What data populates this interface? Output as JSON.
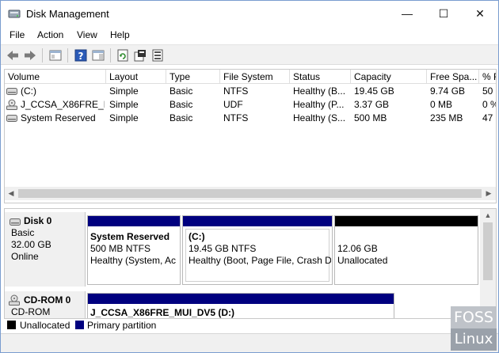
{
  "window": {
    "title": "Disk Management"
  },
  "controls": {
    "minimize": "—",
    "maximize": "☐",
    "close": "✕"
  },
  "menu": {
    "file": "File",
    "action": "Action",
    "view": "View",
    "help": "Help"
  },
  "toolbar": {
    "icons": [
      "back-arrow-icon",
      "forward-arrow-icon",
      "console-tree-icon",
      "help-icon",
      "show-pane-icon",
      "refresh-icon",
      "properties-icon",
      "rescan-disks-icon"
    ]
  },
  "volumes": {
    "columns": [
      "Volume",
      "Layout",
      "Type",
      "File System",
      "Status",
      "Capacity",
      "Free Spa...",
      "% F"
    ],
    "rows": [
      {
        "volume": "(C:)",
        "layout": "Simple",
        "type": "Basic",
        "fs": "NTFS",
        "status": "Healthy (B...",
        "capacity": "19.45 GB",
        "free": "9.74 GB",
        "pct": "50"
      },
      {
        "volume": "J_CCSA_X86FRE_M...",
        "layout": "Simple",
        "type": "Basic",
        "fs": "UDF",
        "status": "Healthy (P...",
        "capacity": "3.37 GB",
        "free": "0 MB",
        "pct": "0 %"
      },
      {
        "volume": "System Reserved",
        "layout": "Simple",
        "type": "Basic",
        "fs": "NTFS",
        "status": "Healthy (S...",
        "capacity": "500 MB",
        "free": "235 MB",
        "pct": "47"
      }
    ]
  },
  "disk0": {
    "name": "Disk 0",
    "kind": "Basic",
    "size": "32.00 GB",
    "state": "Online",
    "partitions": [
      {
        "name": "System Reserved",
        "size": "500 MB NTFS",
        "status": "Healthy (System, Ac"
      },
      {
        "name": "(C:)",
        "size": "19.45 GB NTFS",
        "status": "Healthy (Boot, Page File, Crash Du"
      },
      {
        "name": "",
        "size": "12.06 GB",
        "status": "Unallocated"
      }
    ]
  },
  "cdrom0": {
    "name": "CD-ROM 0",
    "kind": "CD-ROM",
    "partition": "J_CCSA_X86FRE_MUI_DV5 (D:)"
  },
  "legend": {
    "unallocated": "Unallocated",
    "primary": "Primary partition"
  },
  "watermark": {
    "line1": "FOSS",
    "line2": "Linux"
  },
  "colors": {
    "primary": "#00007f",
    "unallocated": "#000000",
    "accent": "#0078d7"
  }
}
